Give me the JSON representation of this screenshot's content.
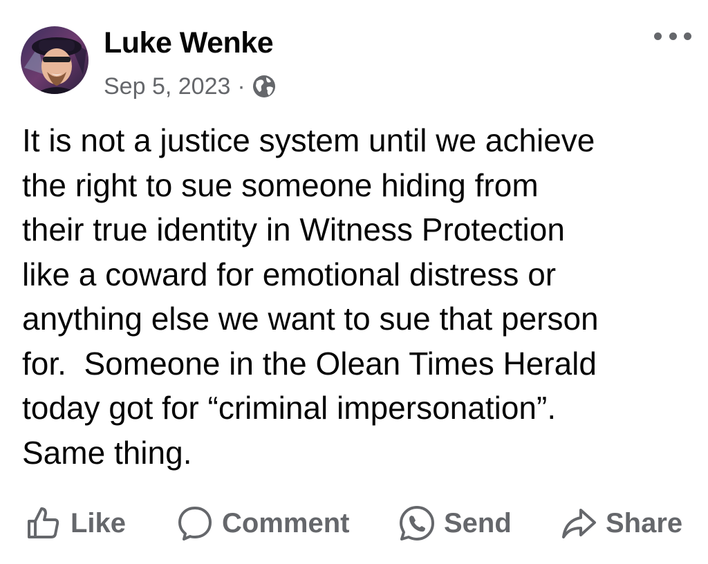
{
  "post": {
    "author": "Luke Wenke",
    "date": "Sep 5, 2023",
    "separator": "·",
    "privacy_icon": "globe-icon",
    "menu_icon": "more-options-icon",
    "text_lines": [
      "It is not a justice system until we achieve",
      "the right to sue someone hiding from",
      "their true identity in Witness Protection",
      "like a coward for emotional distress or",
      "anything else we want to sue that person",
      "for.  Someone in the Olean Times Herald",
      "today got for “criminal impersonation”.",
      "Same thing."
    ]
  },
  "actions": {
    "like": {
      "label": "Like",
      "icon": "thumbs-up-icon"
    },
    "comment": {
      "label": "Comment",
      "icon": "comment-bubble-icon"
    },
    "send": {
      "label": "Send",
      "icon": "whatsapp-icon"
    },
    "share": {
      "label": "Share",
      "icon": "share-arrow-icon"
    }
  },
  "colors": {
    "primary_text": "#050505",
    "secondary_text": "#65676b",
    "background": "#ffffff"
  }
}
